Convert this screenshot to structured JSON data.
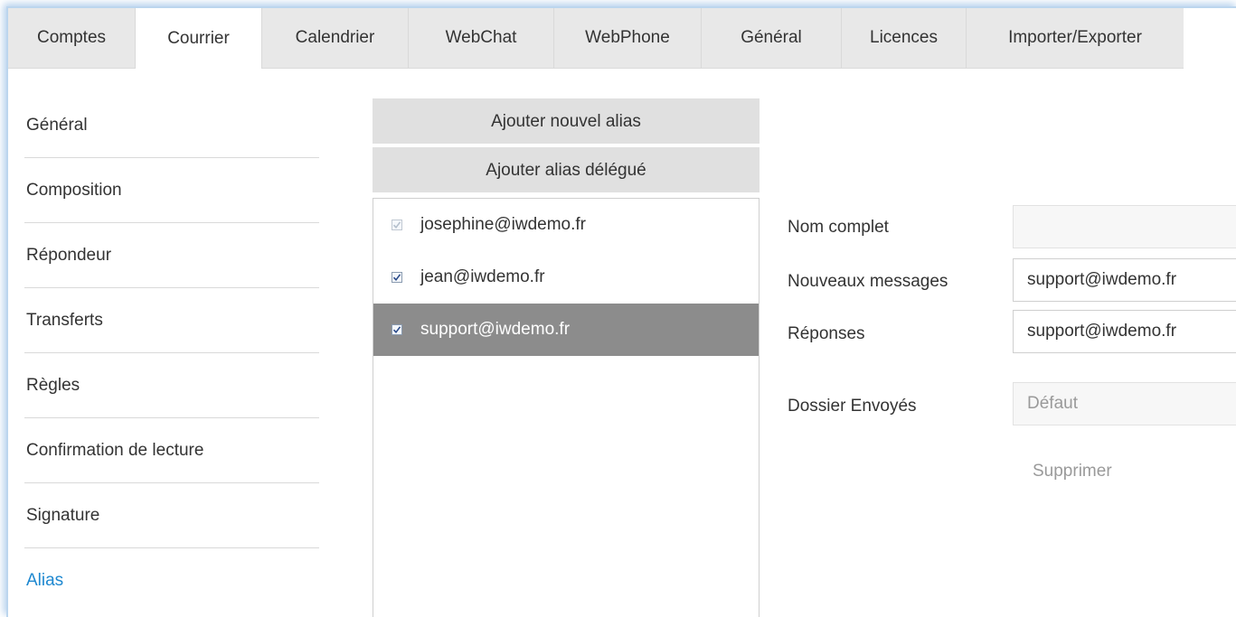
{
  "tabs": [
    "Comptes",
    "Courrier",
    "Calendrier",
    "WebChat",
    "WebPhone",
    "Général",
    "Licences",
    "Importer/Exporter"
  ],
  "active_tab": "Courrier",
  "sidebar": {
    "items": [
      "Général",
      "Composition",
      "Répondeur",
      "Transferts",
      "Règles",
      "Confirmation de lecture",
      "Signature",
      "Alias"
    ],
    "active": "Alias"
  },
  "buttons": {
    "add_alias": "Ajouter nouvel alias",
    "add_delegated": "Ajouter alias délégué",
    "delete": "Supprimer"
  },
  "aliases": [
    {
      "email": "josephine@iwdemo.fr",
      "checked": true,
      "disabled": true,
      "selected": false
    },
    {
      "email": "jean@iwdemo.fr",
      "checked": true,
      "disabled": false,
      "selected": false
    },
    {
      "email": "support@iwdemo.fr",
      "checked": true,
      "disabled": false,
      "selected": true
    }
  ],
  "form": {
    "full_name_label": "Nom complet",
    "full_name_value": "",
    "new_messages_label": "Nouveaux messages",
    "new_messages_value": "support@iwdemo.fr",
    "replies_label": "Réponses",
    "replies_value": "support@iwdemo.fr",
    "sent_folder_label": "Dossier Envoyés",
    "sent_folder_value": "Défaut"
  },
  "colors": {
    "active_link": "#1e88d0",
    "selected_row": "#8c8c8c",
    "tab_bar": "#e8e8e8",
    "button_bg": "#e0e0e0"
  }
}
